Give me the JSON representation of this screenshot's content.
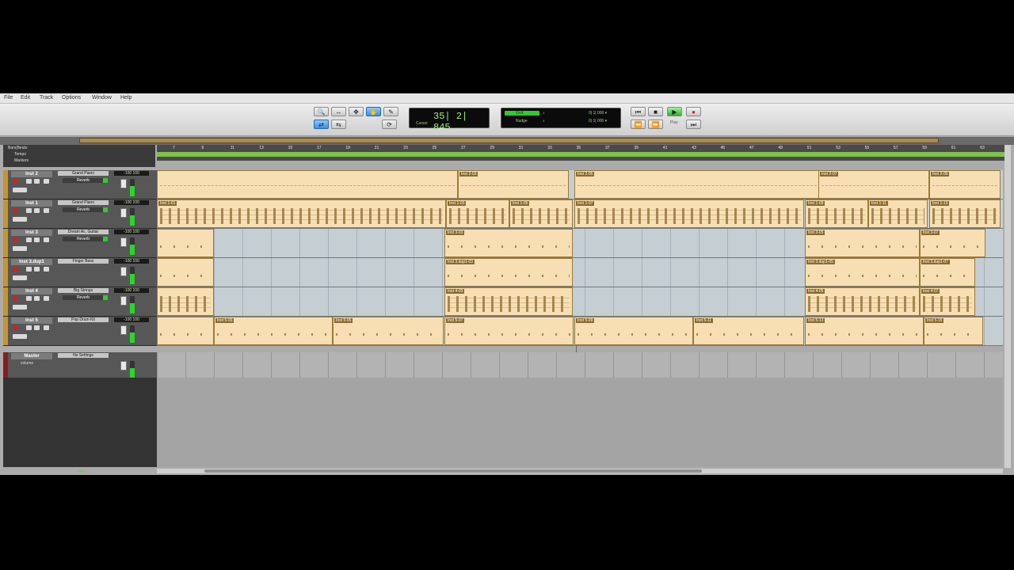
{
  "menu": [
    "File",
    "Edit",
    "Track",
    "Options",
    "Window",
    "Help"
  ],
  "toolbar": {
    "counter_main": "35| 2| 845",
    "counter_sub": "Cursor",
    "grid_label": "Grid",
    "nudge_label": "Nudge",
    "grid_value": "0| 1| 000 ▾",
    "nudge_value": "0| 1| 000 ▾",
    "play_label": "Play"
  },
  "session": {
    "name": "Bars|Beats",
    "rulers": [
      "Tempo",
      "Markers"
    ],
    "bar_numbers": [
      "7",
      "9",
      "11",
      "13",
      "15",
      "17",
      "19",
      "21",
      "23",
      "25",
      "27",
      "29",
      "31",
      "33",
      "35",
      "37",
      "39",
      "41",
      "43",
      "45",
      "47",
      "49",
      "51",
      "53",
      "55",
      "57",
      "59",
      "61",
      "63"
    ]
  },
  "tracks": [
    {
      "name": "Inst 2",
      "instrument": "Grand Piano",
      "plugin": "Reverb",
      "volume": "-100 100",
      "clips": [
        {
          "label": ""
        },
        {
          "label": "Inst 2-03"
        },
        {
          "label": "Inst 2-05"
        },
        {
          "label": "Inst 2-07"
        },
        {
          "label": "Inst 2-09"
        }
      ]
    },
    {
      "name": "Inst 1",
      "instrument": "Grand Piano",
      "plugin": "Reverb",
      "volume": "-100 100",
      "clips": [
        {
          "label": "Inst 1-01"
        },
        {
          "label": "Inst 1-03"
        },
        {
          "label": "Inst 1-05"
        },
        {
          "label": "Inst 1-07"
        },
        {
          "label": "Inst 1-09"
        },
        {
          "label": "Inst 1-11"
        },
        {
          "label": "Inst 1-13"
        }
      ]
    },
    {
      "name": "Inst 3",
      "instrument": "Dream Ac. Guitar",
      "plugin": "Reverb",
      "volume": "-100 100",
      "clips": [
        {
          "label": ""
        },
        {
          "label": "Inst 3-03"
        },
        {
          "label": "Inst 3-05"
        },
        {
          "label": "Inst 3-07"
        }
      ]
    },
    {
      "name": "Inst 3.dup1",
      "instrument": "Finger Bass",
      "plugin": "",
      "volume": "-100 100",
      "clips": [
        {
          "label": ""
        },
        {
          "label": "Inst 3.dup1-03"
        },
        {
          "label": "Inst 3.dup1-05"
        },
        {
          "label": "Inst 3.dup1-07"
        }
      ]
    },
    {
      "name": "Inst 4",
      "instrument": "Big Strings",
      "plugin": "Reverb",
      "volume": "-100 100",
      "clips": [
        {
          "label": ""
        },
        {
          "label": "Inst 4-03"
        },
        {
          "label": "Inst 4-05"
        },
        {
          "label": "Inst 4-07"
        }
      ]
    },
    {
      "name": "Inst 5",
      "instrument": "Pop Drum Kit",
      "plugin": "",
      "volume": "-100 100",
      "clips": [
        {
          "label": ""
        },
        {
          "label": "Inst 5-03"
        },
        {
          "label": "Inst 5-05"
        },
        {
          "label": "Inst 5-07"
        },
        {
          "label": "Inst 5-09"
        },
        {
          "label": "Inst 5-11"
        },
        {
          "label": "Inst 5-13"
        },
        {
          "label": "Inst 5-15"
        }
      ]
    }
  ],
  "master": {
    "name": "Master",
    "instrument": "No Settings",
    "sub": "volume",
    "volume": "-100 100"
  },
  "status": {
    "play": "play"
  },
  "colors": {
    "clip_fill": "#f7dfb3",
    "track_color": "#c8952a",
    "tempo_ruler": "#7ec24a",
    "counter_text": "#9ef07a"
  }
}
